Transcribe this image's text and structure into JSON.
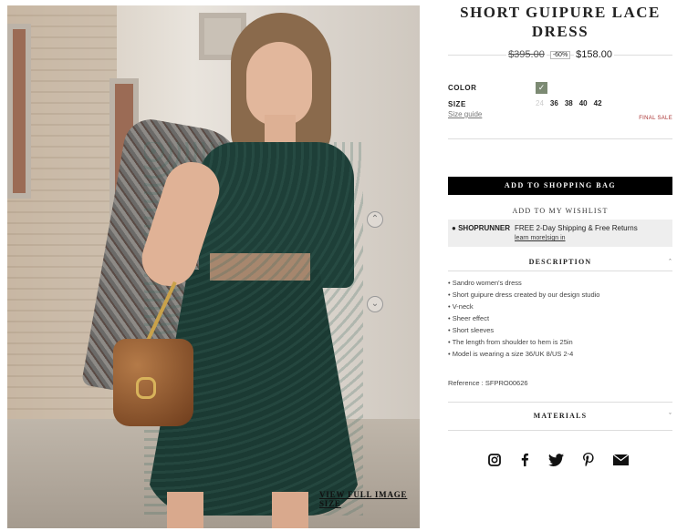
{
  "product": {
    "title": "SHORT GUIPURE LACE DRESS",
    "old_price": "$395.00",
    "discount": "-60%",
    "new_price": "$158.00"
  },
  "options": {
    "color_label": "COLOR",
    "size_label": "SIZE",
    "sizes": [
      "24",
      "36",
      "38",
      "40",
      "42"
    ],
    "sizes_available": [
      false,
      true,
      true,
      true,
      true
    ],
    "size_guide": "Size guide",
    "final_sale": "FINAL SALE",
    "selected_color": "#7c8a73"
  },
  "actions": {
    "add_to_bag": "ADD TO SHOPPING BAG",
    "wishlist": "ADD TO MY WISHLIST"
  },
  "shoprunner": {
    "brand": "SHOPRUNNER",
    "offer": "FREE 2-Day Shipping & Free Returns",
    "learn_more": "learn more",
    "sign_in": "sign in"
  },
  "description": {
    "heading": "DESCRIPTION",
    "items": [
      "Sandro women's dress",
      "Short guipure dress created by our design studio",
      "V-neck",
      "Sheer effect",
      "Short sleeves",
      "The length from shoulder to hem is 25in",
      "Model is wearing a size 36/UK 8/US 2-4"
    ],
    "reference": "Reference : SFPRO00626"
  },
  "materials": {
    "heading": "MATERIALS"
  },
  "image": {
    "view_full": "VIEW FULL IMAGE SIZE"
  },
  "social": [
    "instagram-icon",
    "facebook-icon",
    "twitter-icon",
    "pinterest-icon",
    "mail-icon"
  ]
}
